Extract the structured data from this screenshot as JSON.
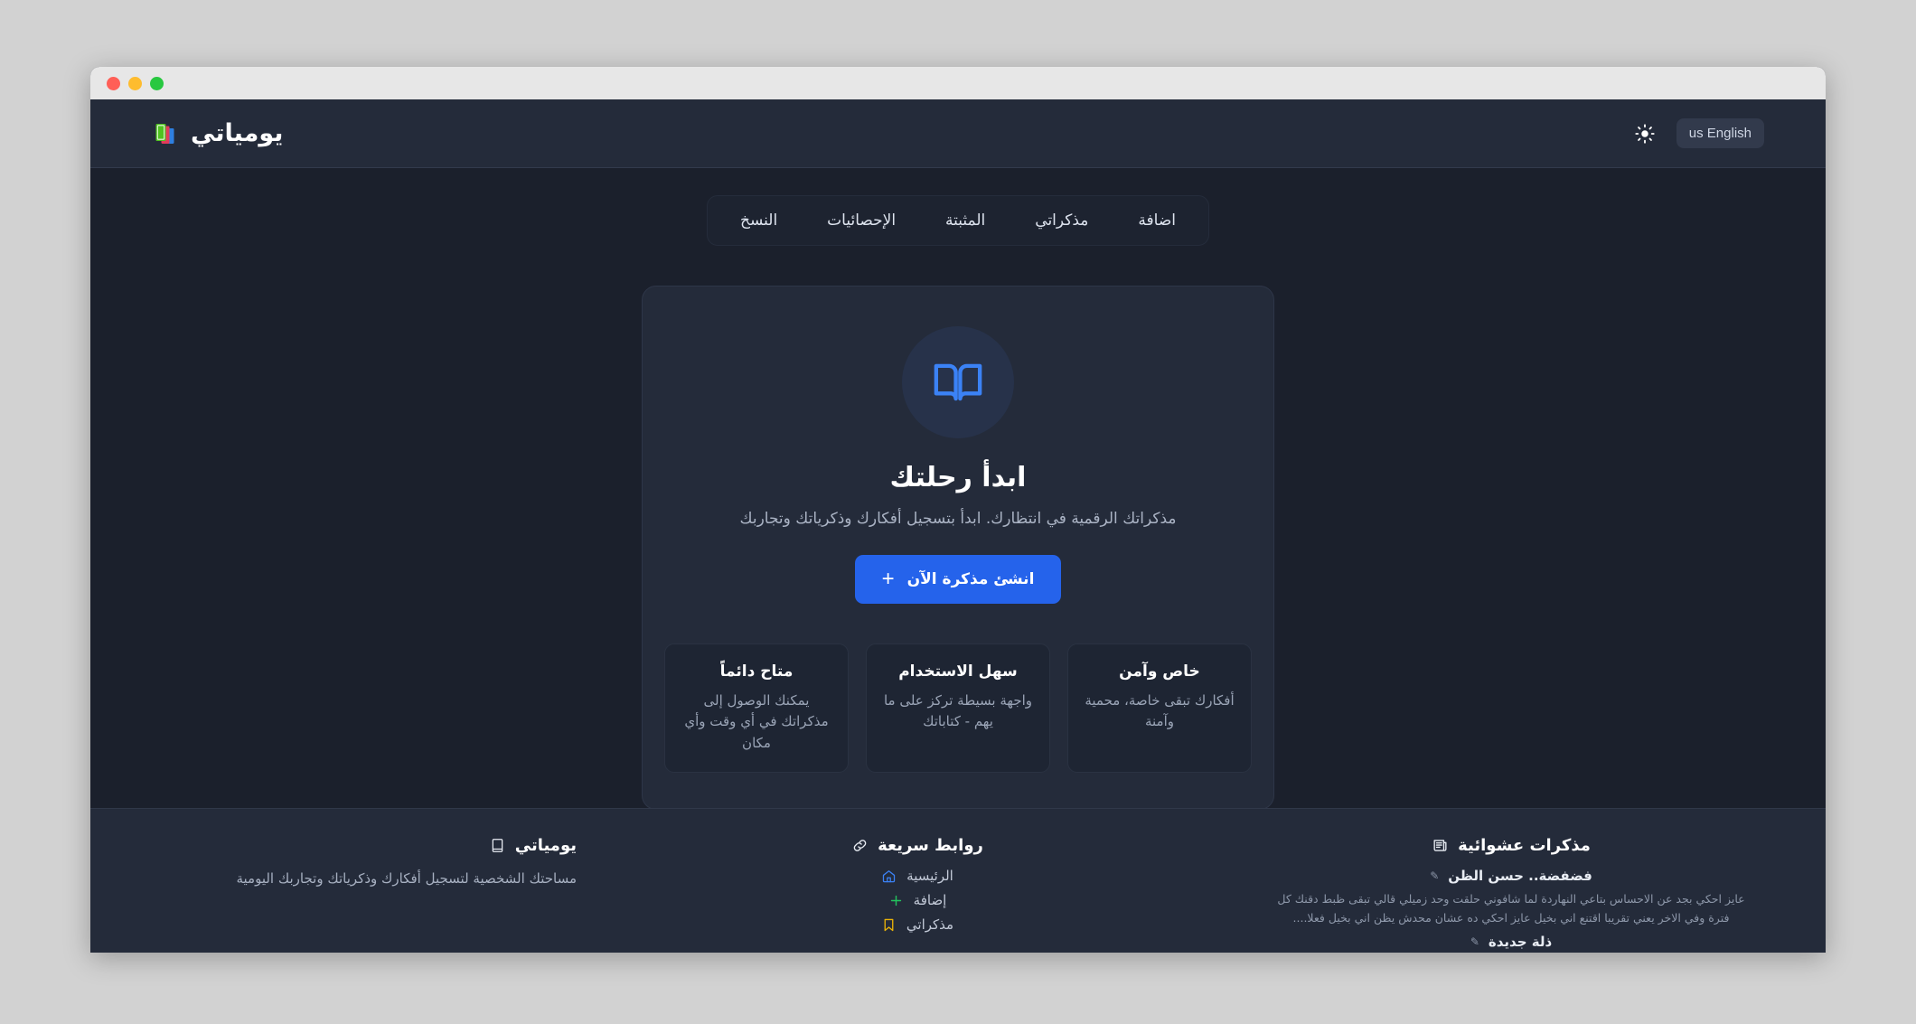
{
  "window": {
    "traffic_lights": [
      "close",
      "minimize",
      "zoom"
    ]
  },
  "header": {
    "brand_name": "يومياتي",
    "brand_icon": "books-icon",
    "theme_toggle_icon": "sun-icon",
    "language_label": "us English"
  },
  "nav": {
    "tabs": [
      {
        "label": "اضافة",
        "name": "tab-add"
      },
      {
        "label": "مذكراتي",
        "name": "tab-my-diaries"
      },
      {
        "label": "المثبتة",
        "name": "tab-pinned"
      },
      {
        "label": "الإحصائيات",
        "name": "tab-statistics"
      },
      {
        "label": "النسخ",
        "name": "tab-backups"
      }
    ]
  },
  "hero": {
    "icon": "open-book-icon",
    "title": "ابدأ رحلتك",
    "subtitle": "مذكراتك الرقمية في انتظارك. ابدأ بتسجيل أفكارك وذكرياتك وتجاربك",
    "cta_label": "انشئ مذكرة الآن",
    "cta_plus": "+",
    "cta_color": "#2563eb",
    "features": [
      {
        "title": "متاح دائماً",
        "desc": "يمكنك الوصول إلى مذكراتك في أي وقت وأي مكان"
      },
      {
        "title": "سهل الاستخدام",
        "desc": "واجهة بسيطة تركز على ما يهم - كتاباتك"
      },
      {
        "title": "خاص وآمن",
        "desc": "أفكارك تبقى خاصة، محمية وآمنة"
      }
    ]
  },
  "footer": {
    "brand": {
      "icon": "book-icon",
      "title": "يومياتي",
      "desc": "مساحتك الشخصية لتسجيل أفكارك وذكرياتك وتجاربك اليومية"
    },
    "quick_links": {
      "icon": "link-icon",
      "title": "روابط سريعة",
      "items": [
        {
          "label": "الرئيسية",
          "icon": "home-icon",
          "color": "#3b82f6"
        },
        {
          "label": "إضافة",
          "icon": "plus-icon",
          "color": "#22c55e"
        },
        {
          "label": "مذكراتي",
          "icon": "bookmark-icon",
          "color": "#eab308"
        }
      ]
    },
    "random": {
      "icon": "newspaper-icon",
      "title": "مذكرات عشوائية",
      "items": [
        {
          "title": "فضفضة.. حسن الظن",
          "excerpt": "عايز احكي بجد عن الاحساس بتاعي النهاردة لما شافوني حلقت وحد زميلي قالي تبقى ظبط دقنك كل فترة وفي الاخر يعني تقريبا اقتنع اني بخيل عايز احكي ده عشان محدش يظن اني بخيل فعلا...."
        },
        {
          "title": "ذلة جديدة",
          "excerpt": ""
        }
      ]
    }
  }
}
